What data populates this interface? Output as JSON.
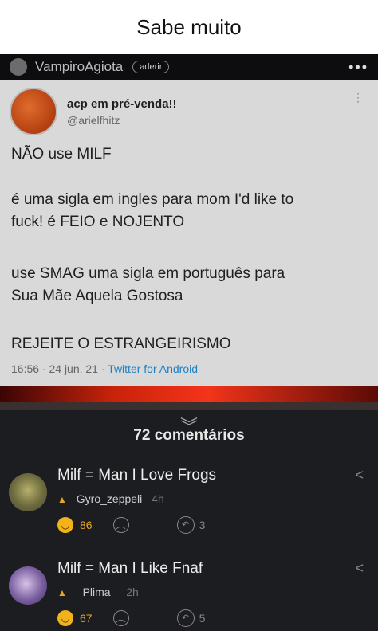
{
  "caption": "Sabe muito",
  "topbar": {
    "title": "VampiroAgiota",
    "join_label": "aderir",
    "more_icon": "•••"
  },
  "tweet": {
    "name": "acp em pré-venda!!",
    "handle": "@arielfhitz",
    "lines": [
      "NÃO use MILF",
      "é uma sigla em ingles para mom I'd like to",
      "fuck! é FEIO e NOJENTO",
      "use SMAG uma sigla em português para",
      "Sua Mãe Aquela Gostosa",
      "REJEITE O ESTRANGEIRISMO"
    ],
    "time": "16:56 · 24 jun. 21 · ",
    "source": "Twitter for Android"
  },
  "comments_count": "72 comentários",
  "comments": [
    {
      "text": "Milf = Man I Love Frogs",
      "user": "Gyro_zeppeli",
      "age": "4h",
      "smiles": "86",
      "replies": "3"
    },
    {
      "text": "Milf = Man I Like Fnaf",
      "user": "_Plima_",
      "age": "2h",
      "smiles": "67",
      "replies": "5"
    }
  ]
}
